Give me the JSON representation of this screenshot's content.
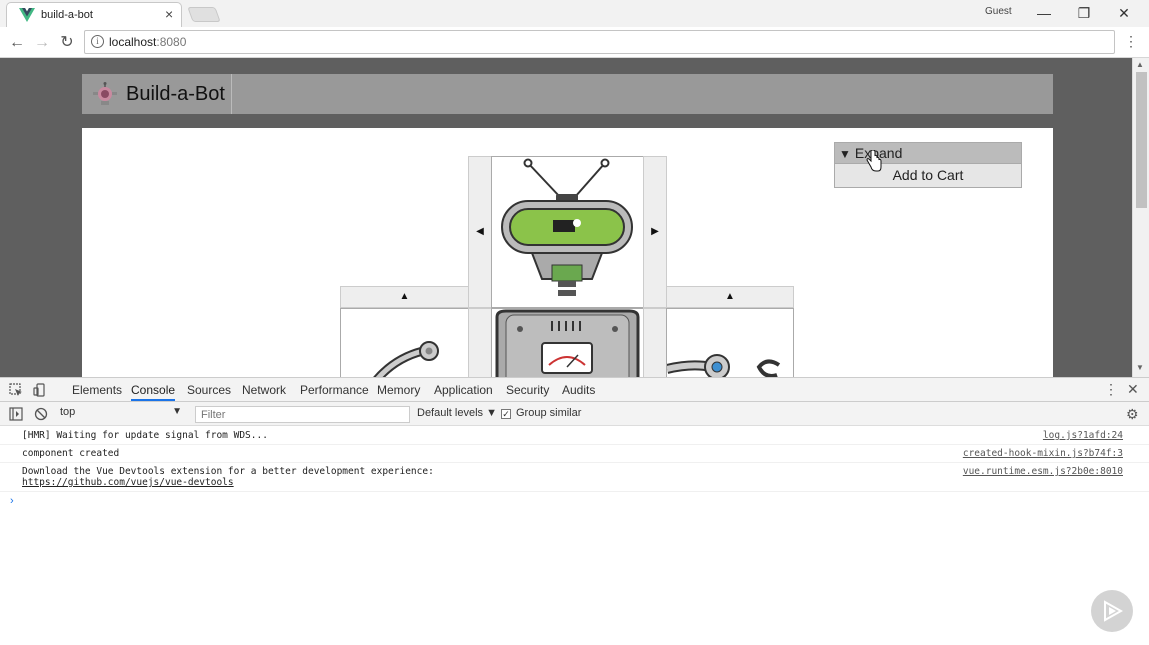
{
  "browser": {
    "tab_title": "build-a-bot",
    "tab_close": "×",
    "user_badge": "Guest",
    "window_minimize": "—",
    "window_restore": "❐",
    "window_close": "✕",
    "url_host": "localhost",
    "url_port": ":8080",
    "menu": "⋮"
  },
  "site": {
    "brand": "Build-a-Bot",
    "preview": {
      "expand_label": "Expand",
      "expand_toggle": "▼",
      "add_to_cart": "Add to Cart"
    },
    "arrows": {
      "head_left": "◀",
      "head_right": "▶",
      "left_arm_up": "▲",
      "right_arm_up": "▲"
    }
  },
  "devtools": {
    "tabs": [
      "Elements",
      "Console",
      "Sources",
      "Network",
      "Performance",
      "Memory",
      "Application",
      "Security",
      "Audits"
    ],
    "active_tab": "Console",
    "context": "top",
    "filter_placeholder": "Filter",
    "levels_label": "Default levels ▼",
    "group_similar_label": "Group similar",
    "logs": [
      {
        "message": "[HMR] Waiting for update signal from WDS...",
        "source": "log.js?1afd:24"
      },
      {
        "message": "component created",
        "source": "created-hook-mixin.js?b74f:3"
      },
      {
        "message": "Download the Vue Devtools extension for a better development experience:",
        "link": "https://github.com/vuejs/vue-devtools",
        "source": "vue.runtime.esm.js?2b0e:8010"
      }
    ],
    "prompt": "›"
  },
  "colors": {
    "header_bg": "#999999",
    "viewport_bg": "#5f5f5f",
    "robot_green": "#8bc34a",
    "devtools_accent": "#1a73e8"
  }
}
